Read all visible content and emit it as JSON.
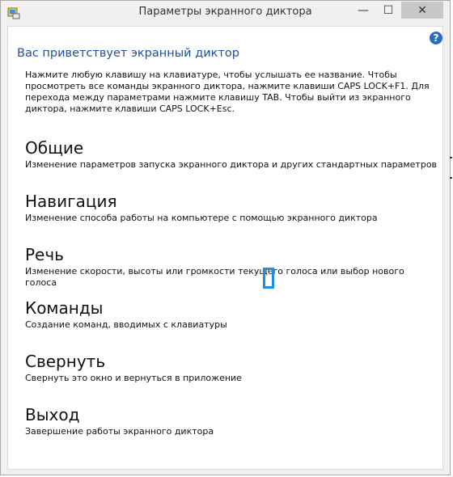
{
  "window": {
    "title": "Параметры экранного диктора",
    "help_symbol": "?"
  },
  "controls": {
    "minimize_symbol": "—",
    "maximize_symbol": "☐",
    "close_symbol": "✕"
  },
  "header": {
    "welcome": "Вас приветствует экранный диктор",
    "intro": "Нажмите любую клавишу на клавиатуре, чтобы услышать ее название. Чтобы просмотреть все команды экранного диктора, нажмите клавиши CAPS LOCK+F1. Для перехода между параметрами нажмите клавишу TAB. Чтобы выйти из экранного диктора, нажмите клавиши CAPS LOCK+Esc."
  },
  "sections": [
    {
      "title": "Общие",
      "description": "Изменение параметров запуска экранного диктора и других стандартных параметров"
    },
    {
      "title": "Навигация",
      "description": "Изменение способа работы на компьютере с помощью экранного диктора"
    },
    {
      "title": "Речь",
      "description": "Изменение скорости, высоты или громкости текущего голоса или выбор нового голоса"
    },
    {
      "title": "Команды",
      "description": "Создание команд, вводимых с клавиатуры"
    },
    {
      "title": "Свернуть",
      "description": "Свернуть это окно и вернуться в приложение"
    },
    {
      "title": "Выход",
      "description": "Завершение работы экранного диктора"
    }
  ],
  "icons": {
    "app": "narrator-app-icon",
    "help": "help-icon",
    "minimize": "minimize-icon",
    "maximize": "maximize-icon",
    "close": "close-icon"
  },
  "colors": {
    "accent": "#1f4f9c",
    "focus": "#1e8fe0",
    "help": "#2a6fbf"
  }
}
